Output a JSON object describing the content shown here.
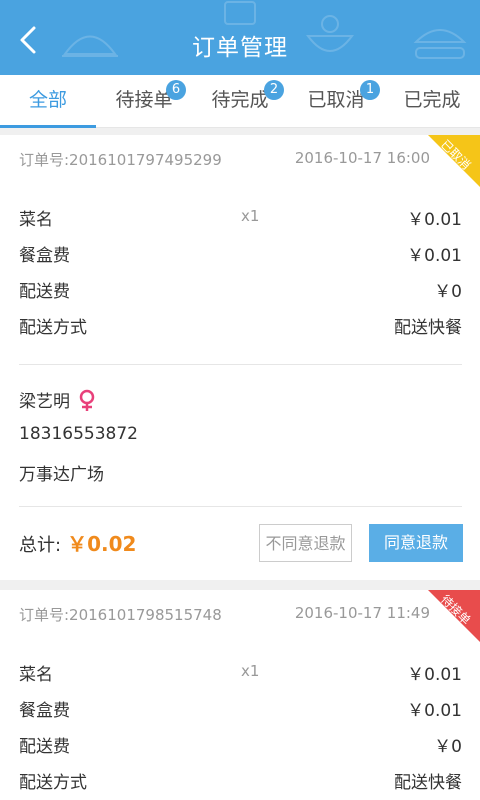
{
  "header": {
    "title": "订单管理"
  },
  "tabs": [
    {
      "label": "全部",
      "badge": ""
    },
    {
      "label": "待接单",
      "badge": "6"
    },
    {
      "label": "待完成",
      "badge": "2"
    },
    {
      "label": "已取消",
      "badge": "1"
    },
    {
      "label": "已完成",
      "badge": ""
    }
  ],
  "orders": [
    {
      "order_no": "订单号:2016101797495299",
      "time": "2016-10-17 16:00",
      "status": "已取消",
      "status_color": "#f5c518",
      "item_name": "菜名",
      "item_qty": "x1",
      "item_price": "￥0.01",
      "box_fee_label": "餐盒费",
      "box_fee": "￥0.01",
      "delivery_fee_label": "配送费",
      "delivery_fee": "￥0",
      "delivery_method_label": "配送方式",
      "delivery_method": "配送快餐",
      "customer_name": "梁艺明",
      "phone": "18316553872",
      "address": "万事达广场",
      "total_label": "总计:",
      "total": "￥0.02",
      "reject_label": "不同意退款",
      "agree_label": "同意退款"
    },
    {
      "order_no": "订单号:2016101798515748",
      "time": "2016-10-17 11:49",
      "status": "待接单",
      "status_color": "#e84c4c",
      "item_name": "菜名",
      "item_qty": "x1",
      "item_price": "￥0.01",
      "box_fee_label": "餐盒费",
      "box_fee": "￥0.01",
      "delivery_fee_label": "配送费",
      "delivery_fee": "￥0",
      "delivery_method_label": "配送方式",
      "delivery_method": "配送快餐"
    }
  ],
  "icons": {
    "back": "back-arrow-icon",
    "gender": "female-icon"
  },
  "colors": {
    "header": "#4aa3e0",
    "accent": "#3d9be0",
    "price": "#f08a1c",
    "female": "#e8407a"
  }
}
